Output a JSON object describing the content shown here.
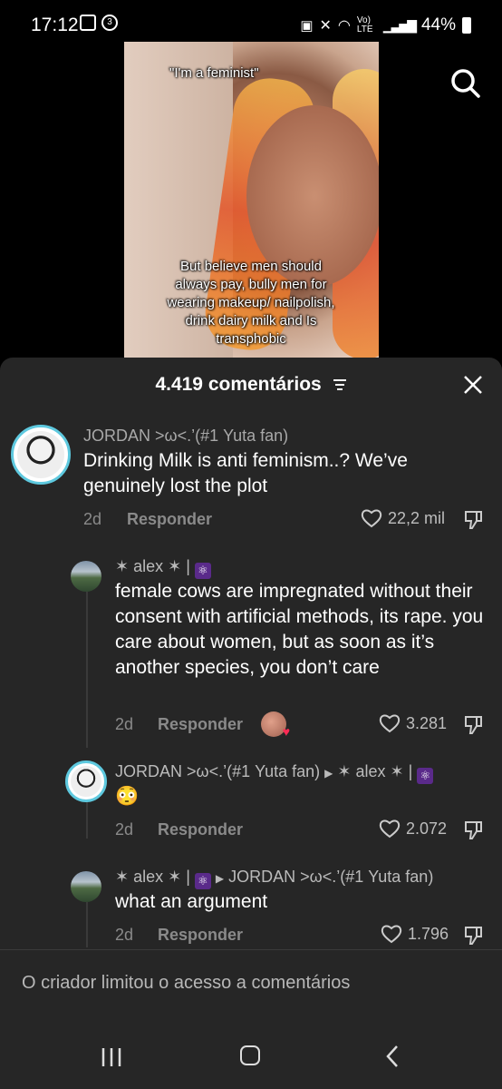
{
  "status_bar": {
    "time": "17:12",
    "notification_badge": "3",
    "network": "Vo) LTE",
    "battery": "44%"
  },
  "video": {
    "overlay_top": "\"I'm a feminist\"",
    "overlay_bottom": "But believe men should always pay, bully men for wearing makeup/ nailpolish, drink dairy milk and Is transphobic"
  },
  "comments_header": {
    "count_label": "4.419 comentários"
  },
  "comments": [
    {
      "user": "JORDAN >ω<.’(#1 Yuta fan)",
      "text": "Drinking Milk is anti feminism..? We’ve genuinely lost the plot",
      "age": "2d",
      "reply_label": "Responder",
      "likes": "22,2 mil"
    },
    {
      "user": "✶ alex ✶ |",
      "text": "female cows are impregnated without their consent with artificial methods, its rape. you care about women, but as soon as it’s another species, you don’t care",
      "age": "2d",
      "reply_label": "Responder",
      "likes": "3.281"
    },
    {
      "user": "JORDAN >ω<.’(#1 Yuta fan)",
      "reply_to": "✶ alex ✶ |",
      "text": "😳",
      "age": "2d",
      "reply_label": "Responder",
      "likes": "2.072"
    },
    {
      "user": "✶ alex ✶ |",
      "reply_to": "JORDAN >ω<.’(#1 Yuta fan)",
      "text": "what an argument",
      "age": "2d",
      "reply_label": "Responder",
      "likes": "1.796"
    }
  ],
  "footer": {
    "limited_text": "O criador limitou o acesso a comentários"
  }
}
